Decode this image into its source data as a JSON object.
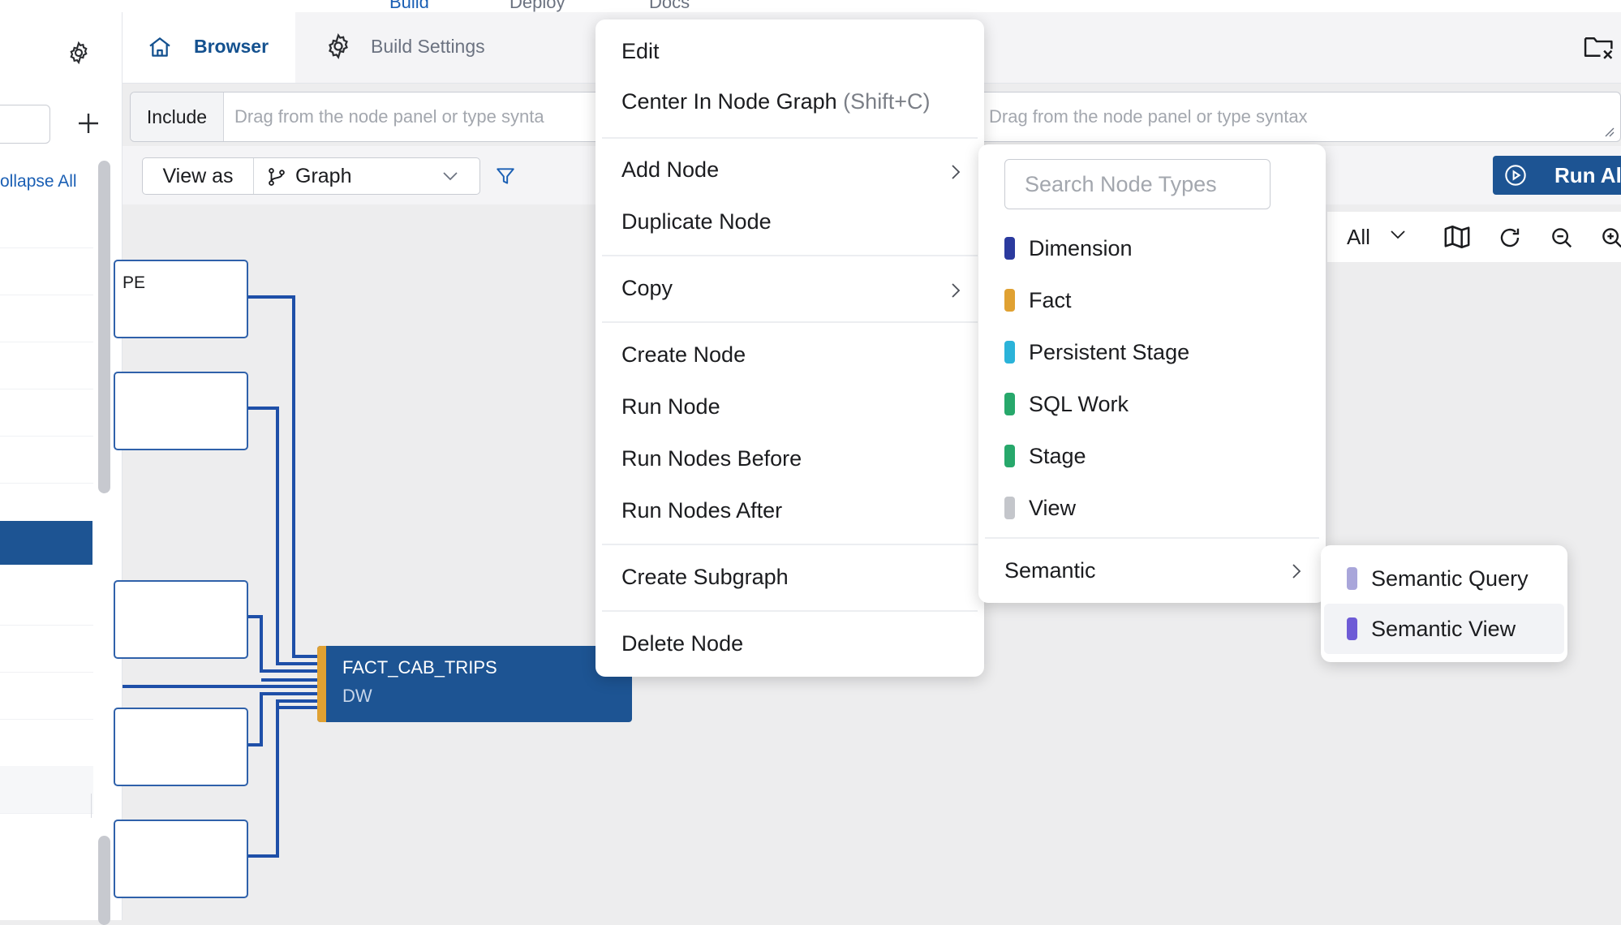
{
  "top_nav": [
    "Build",
    "Deploy",
    "Docs"
  ],
  "sidebar": {
    "collapse_all": "ollapse All"
  },
  "tabs": [
    {
      "label": "Browser",
      "icon": "home-icon",
      "active": true
    },
    {
      "label": "Build Settings",
      "icon": "gear-icon",
      "active": false
    }
  ],
  "filters": {
    "include_label": "Include",
    "include_placeholder": "Drag from the node panel or type synta",
    "exclude_placeholder": "Drag from the node panel or type syntax"
  },
  "view_as": {
    "label": "View as",
    "value": "Graph"
  },
  "run_all": {
    "label": "Run All"
  },
  "graph_toolbar": {
    "scope": "All"
  },
  "graph": {
    "partial_node_label": "PE",
    "selected_node": {
      "name": "FACT_CAB_TRIPS",
      "location": "DW",
      "type_color": "#e0a132"
    }
  },
  "context_menu": {
    "edit": "Edit",
    "center": "Center In Node Graph",
    "center_shortcut": "(Shift+C)",
    "add_node": "Add Node",
    "duplicate": "Duplicate Node",
    "copy": "Copy",
    "create_node": "Create Node",
    "run_node": "Run Node",
    "run_before": "Run Nodes Before",
    "run_after": "Run Nodes After",
    "create_subgraph": "Create Subgraph",
    "delete_node": "Delete Node"
  },
  "node_types_menu": {
    "search_placeholder": "Search Node Types",
    "types": [
      {
        "label": "Dimension",
        "color": "#2b3a9e"
      },
      {
        "label": "Fact",
        "color": "#e0a132"
      },
      {
        "label": "Persistent Stage",
        "color": "#2bb3d9"
      },
      {
        "label": "SQL Work",
        "color": "#27a86b"
      },
      {
        "label": "Stage",
        "color": "#27a86b"
      },
      {
        "label": "View",
        "color": "#c4c6cb"
      }
    ],
    "semantic": "Semantic"
  },
  "semantic_menu": {
    "items": [
      {
        "label": "Semantic Query",
        "color": "#a9a6da"
      },
      {
        "label": "Semantic View",
        "color": "#6e5bd6"
      }
    ]
  },
  "colors": {
    "brand": "#1d5493",
    "link": "#1a5fb4",
    "edge": "#1e4fa8"
  }
}
